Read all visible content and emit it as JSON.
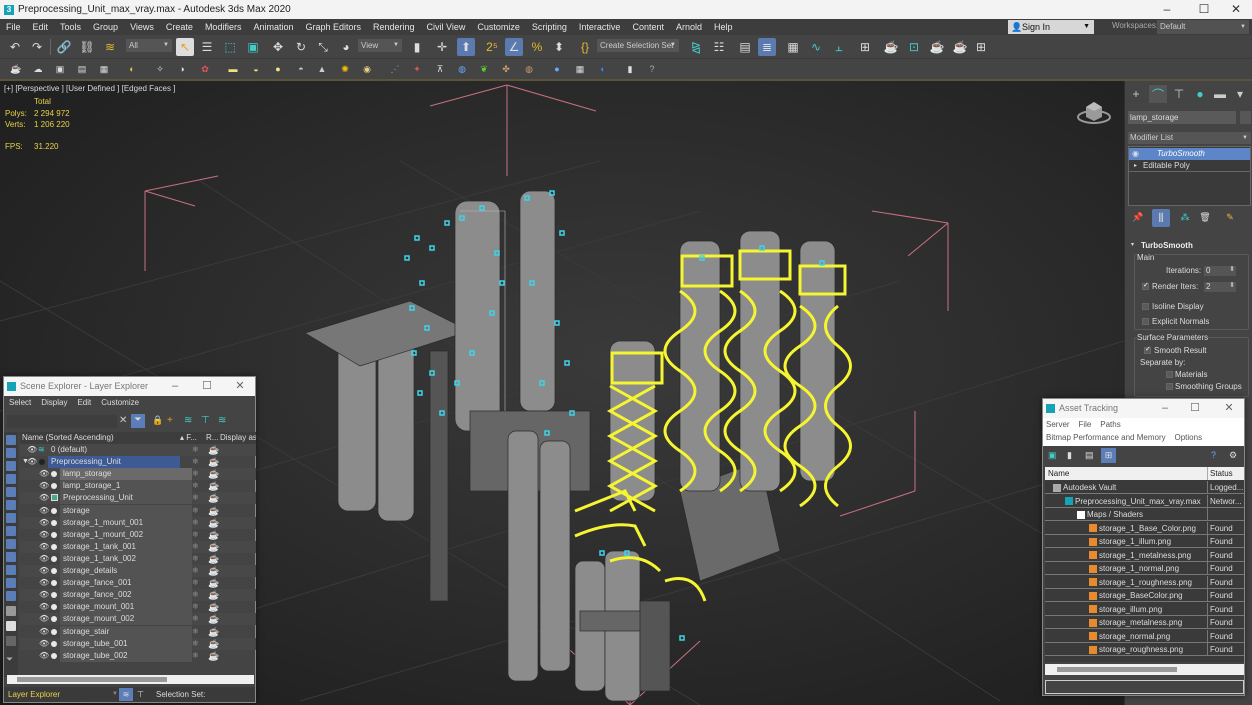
{
  "window": {
    "title": "Preprocessing_Unit_max_vray.max - Autodesk 3ds Max 2020",
    "app_icon": "3ds-max-logo-icon",
    "controls": [
      "minimize",
      "maximize",
      "close"
    ]
  },
  "menubar": {
    "items": [
      "File",
      "Edit",
      "Tools",
      "Group",
      "Views",
      "Create",
      "Modifiers",
      "Animation",
      "Graph Editors",
      "Rendering",
      "Civil View",
      "Customize",
      "Scripting",
      "Interactive",
      "Content",
      "Arnold",
      "Help"
    ],
    "sign_in": "Sign In",
    "workspaces_label": "Workspaces:",
    "workspace_value": "Default"
  },
  "toolbar": {
    "selection_filter": "All",
    "ref_coord": "View",
    "selection_set_placeholder": "Create Selection Set",
    "icons_row1": [
      "undo-icon",
      "redo-icon",
      "link-icon",
      "unlink-icon",
      "bind-space-warp-icon",
      "select-object-icon",
      "select-by-name-icon",
      "rect-selection-icon",
      "window-crossing-icon",
      "move-icon",
      "rotate-icon",
      "scale-icon",
      "place-icon",
      "pivot-icon",
      "select-manipulate-icon",
      "keyboard-shortcut-icon",
      "snaps-toggle-icon",
      "angle-snap-icon",
      "percent-snap-icon",
      "spinner-snap-icon",
      "edit-named-sets-icon",
      "mirror-icon",
      "align-icon",
      "scene-explorer-icon",
      "layer-explorer-icon",
      "ribbon-icon",
      "curve-editor-icon",
      "schematic-view-icon",
      "material-editor-icon",
      "render-setup-icon",
      "rendered-frame-icon",
      "render-icon",
      "render-online-icon",
      "render-in-cloud-icon"
    ],
    "icons_row2": [
      "teapot-icon",
      "cloud-icon",
      "modifier-icon",
      "panel-icon",
      "grid-icon",
      "camera-icon",
      "helper-icon",
      "space-warp-icon",
      "system-icon",
      "light-area-icon",
      "dome-icon",
      "sphere-light-icon",
      "plane-icon",
      "cone-icon",
      "sun-icon",
      "sphere-icon",
      "hair-icon",
      "particle-icon",
      "object-paint-icon",
      "tree-icon",
      "brush-icon",
      "proxy-icon",
      "sphere-material-icon",
      "layers-icon",
      "toggle-icon",
      "render-elements-icon",
      "help-icon"
    ]
  },
  "viewport": {
    "label": "[+] [Perspective ] [User Defined ] [Edged Faces ]",
    "stats": {
      "header": "Total",
      "polys_label": "Polys:",
      "polys_value": "2 294 972",
      "verts_label": "Verts:",
      "verts_value": "1 206 220",
      "fps_label": "FPS:",
      "fps_value": "31.220"
    },
    "colors": {
      "selection": "#f5f532",
      "helpers": "#3fd3e8",
      "gizmo": "#c87080"
    }
  },
  "command_panel": {
    "tabs": [
      "create-icon",
      "modify-icon",
      "hierarchy-icon",
      "motion-icon",
      "display-icon",
      "utilities-icon"
    ],
    "object_name": "lamp_storage",
    "modifier_list": "Modifier List",
    "stack": [
      {
        "label": "TurboSmooth",
        "selected": true
      },
      {
        "label": "Editable Poly",
        "selected": false
      }
    ],
    "rollout": {
      "title": "TurboSmooth",
      "main_group": "Main",
      "iterations_label": "Iterations:",
      "iterations_value": "0",
      "render_iters_label": "Render Iters:",
      "render_iters_value": "2",
      "render_iters_checked": true,
      "isoline_display": "Isoline Display",
      "explicit_normals": "Explicit Normals",
      "surface_group": "Surface Parameters",
      "smooth_result": "Smooth Result",
      "smooth_result_checked": true,
      "separate_by": "Separate by:",
      "materials": "Materials",
      "smoothing_groups": "Smoothing Groups"
    }
  },
  "scene_explorer": {
    "title": "Scene Explorer - Layer Explorer",
    "menu": [
      "Select",
      "Display",
      "Edit",
      "Customize"
    ],
    "columns": [
      "Name (Sorted Ascending)",
      "▴ F...",
      "R...",
      "Display as B"
    ],
    "rows": [
      {
        "name": "0 (default)",
        "indent": 0,
        "kind": "layer"
      },
      {
        "name": "Preprocessing_Unit",
        "indent": 0,
        "kind": "layer-active"
      },
      {
        "name": "lamp_storage",
        "indent": 1,
        "kind": "object",
        "selected": true
      },
      {
        "name": "lamp_storage_1",
        "indent": 1,
        "kind": "object"
      },
      {
        "name": "Preprocessing_Unit",
        "indent": 1,
        "kind": "group"
      },
      {
        "name": "storage",
        "indent": 1,
        "kind": "object"
      },
      {
        "name": "storage_1_mount_001",
        "indent": 1,
        "kind": "object"
      },
      {
        "name": "storage_1_mount_002",
        "indent": 1,
        "kind": "object"
      },
      {
        "name": "storage_1_tank_001",
        "indent": 1,
        "kind": "object"
      },
      {
        "name": "storage_1_tank_002",
        "indent": 1,
        "kind": "object"
      },
      {
        "name": "storage_details",
        "indent": 1,
        "kind": "object"
      },
      {
        "name": "storage_fance_001",
        "indent": 1,
        "kind": "object"
      },
      {
        "name": "storage_fance_002",
        "indent": 1,
        "kind": "object"
      },
      {
        "name": "storage_mount_001",
        "indent": 1,
        "kind": "object"
      },
      {
        "name": "storage_mount_002",
        "indent": 1,
        "kind": "object"
      },
      {
        "name": "storage_stair",
        "indent": 1,
        "kind": "object"
      },
      {
        "name": "storage_tube_001",
        "indent": 1,
        "kind": "object"
      },
      {
        "name": "storage_tube_002",
        "indent": 1,
        "kind": "object"
      }
    ],
    "footer_mode": "Layer Explorer",
    "footer_selection_set": "Selection Set:"
  },
  "asset_tracking": {
    "title": "Asset Tracking",
    "menu_row1": [
      "Server",
      "File",
      "Paths"
    ],
    "menu_row2": [
      "Bitmap Performance and Memory",
      "Options"
    ],
    "columns": [
      "Name",
      "Status"
    ],
    "rows": [
      {
        "name": "Autodesk Vault",
        "status": "Logged...",
        "level": 1,
        "icon": "vault-icon"
      },
      {
        "name": "Preprocessing_Unit_max_vray.max",
        "status": "Networ...",
        "level": 2,
        "icon": "max-file-icon"
      },
      {
        "name": "Maps / Shaders",
        "status": "",
        "level": 3,
        "icon": "maps-folder-icon"
      },
      {
        "name": "storage_1_Base_Color.png",
        "status": "Found",
        "level": 4,
        "icon": "bitmap-icon"
      },
      {
        "name": "storage_1_illum.png",
        "status": "Found",
        "level": 4,
        "icon": "bitmap-icon"
      },
      {
        "name": "storage_1_metalness.png",
        "status": "Found",
        "level": 4,
        "icon": "bitmap-icon"
      },
      {
        "name": "storage_1_normal.png",
        "status": "Found",
        "level": 4,
        "icon": "bitmap-icon"
      },
      {
        "name": "storage_1_roughness.png",
        "status": "Found",
        "level": 4,
        "icon": "bitmap-icon"
      },
      {
        "name": "storage_BaseColor.png",
        "status": "Found",
        "level": 4,
        "icon": "bitmap-icon"
      },
      {
        "name": "storage_illum.png",
        "status": "Found",
        "level": 4,
        "icon": "bitmap-icon"
      },
      {
        "name": "storage_metalness.png",
        "status": "Found",
        "level": 4,
        "icon": "bitmap-icon"
      },
      {
        "name": "storage_normal.png",
        "status": "Found",
        "level": 4,
        "icon": "bitmap-icon"
      },
      {
        "name": "storage_roughness.png",
        "status": "Found",
        "level": 4,
        "icon": "bitmap-icon"
      }
    ]
  }
}
